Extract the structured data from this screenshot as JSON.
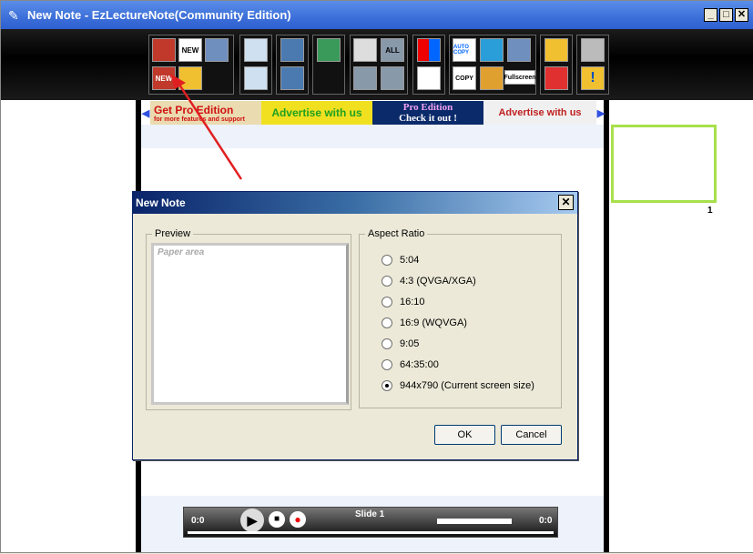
{
  "window": {
    "title": "New Note - EzLectureNote(Community Edition)"
  },
  "toolbar": {
    "new_label": "NEW",
    "new2_label": "NEW",
    "autocopy_label": "AUTO COPY",
    "copy_label": "COPY",
    "all_label": "ALL",
    "fullscreen_label": "Fullscreen",
    "help_label": "!"
  },
  "ads": {
    "get_pro_title": "Get Pro Edition",
    "get_pro_sub": "for more features and support",
    "advertise1": "Advertise with us",
    "pro_edition": "Pro Edition",
    "check_it_out": "Check it out !",
    "advertise2": "Advertise with us"
  },
  "thumbnail": {
    "number": "1"
  },
  "player": {
    "slide": "Slide 1",
    "time_left": "0:0",
    "time_right": "0:0"
  },
  "dialog": {
    "title": "New Note",
    "close": "✕",
    "preview_legend": "Preview",
    "paper_area": "Paper area",
    "aspect_legend": "Aspect Ratio",
    "options": [
      "5:04",
      "4:3 (QVGA/XGA)",
      "16:10",
      "16:9 (WQVGA)",
      "9:05",
      "64:35:00",
      "944x790 (Current screen size)"
    ],
    "selected_option": "944x790 (Current screen size)",
    "ok": "OK",
    "cancel": "Cancel"
  },
  "colors": {
    "accent_green": "#a8e04c",
    "title_blue": "#3c6fd9",
    "arrow_red": "#e02020"
  }
}
